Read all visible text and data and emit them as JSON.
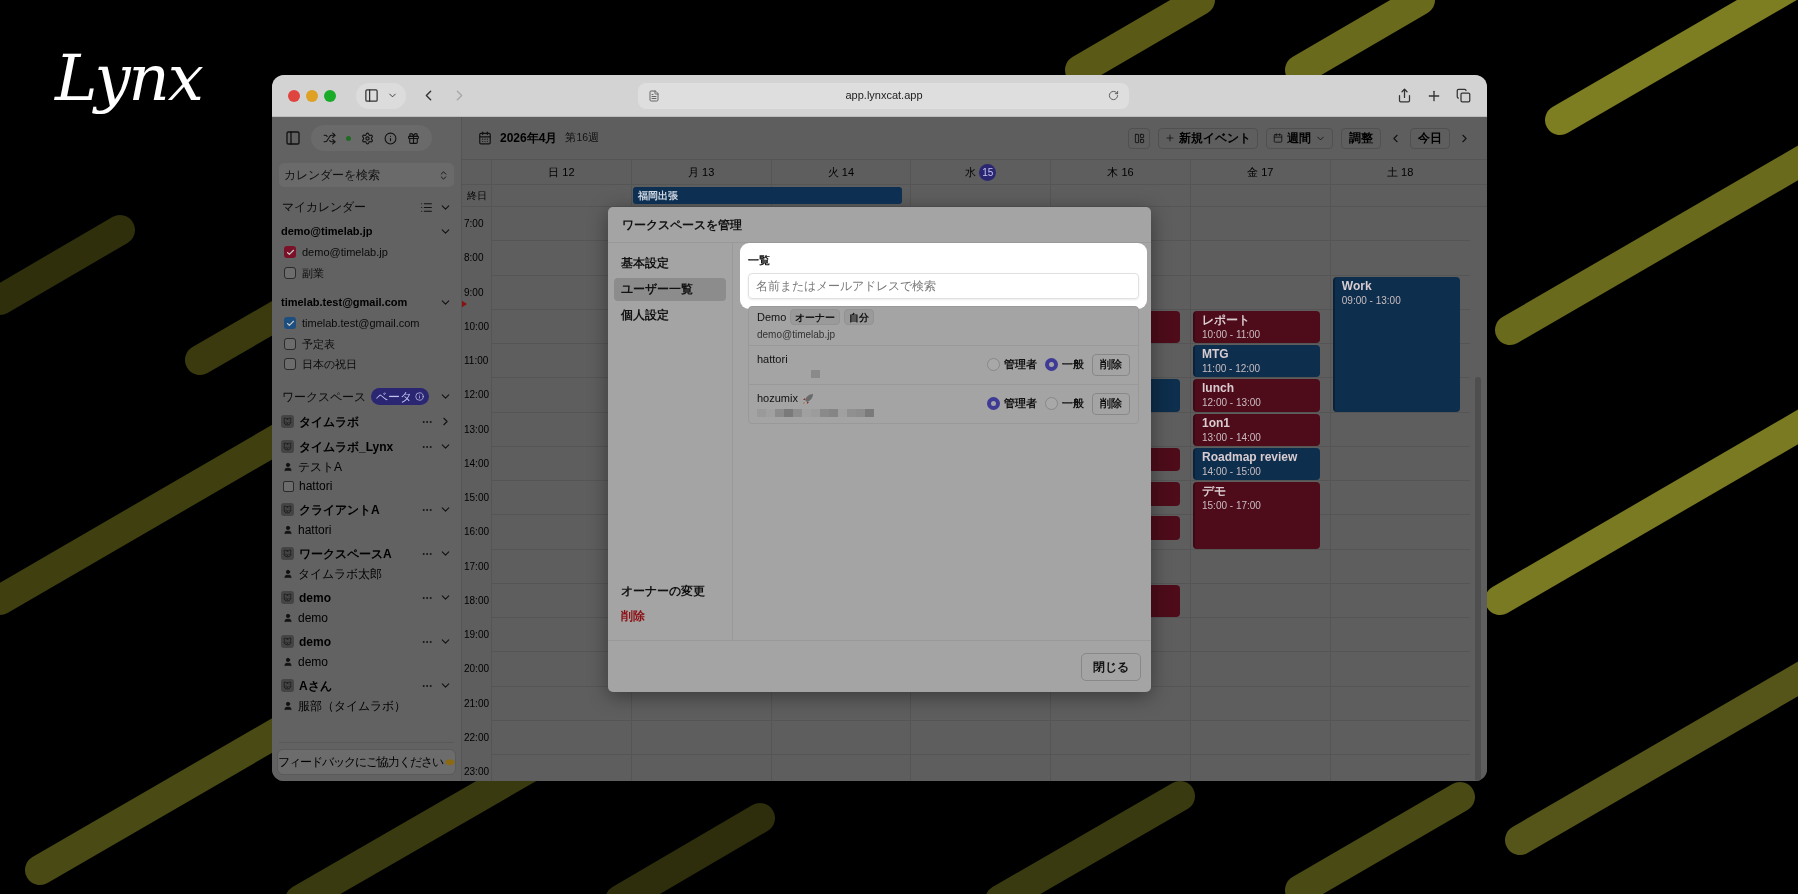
{
  "brand": "Lynx",
  "browser": {
    "url": "app.lynxcat.app"
  },
  "sidebar": {
    "search_placeholder": "カレンダーを検索",
    "my_calendars": {
      "title": "マイカレンダー",
      "accounts": [
        {
          "name": "demo@timelab.jp",
          "calendars": [
            {
              "name": "demo@timelab.jp",
              "checked": true,
              "color": "#7a1128"
            },
            {
              "name": "副業",
              "checked": false
            }
          ]
        },
        {
          "name": "timelab.test@gmail.com",
          "calendars": [
            {
              "name": "timelab.test@gmail.com",
              "checked": true,
              "color": "#1c4f80"
            },
            {
              "name": "予定表",
              "checked": false
            },
            {
              "name": "日本の祝日",
              "checked": false
            }
          ]
        }
      ]
    },
    "workspaces": {
      "title": "ワークスペース",
      "badge": "ベータ",
      "items": [
        {
          "name": "タイムラボ",
          "expanded": false
        },
        {
          "name": "タイムラボ_Lynx",
          "expanded": true,
          "members": [
            {
              "kind": "person",
              "name": "テストA"
            },
            {
              "kind": "checkbox",
              "name": "hattori",
              "checked": false
            }
          ]
        },
        {
          "name": "クライアントA",
          "expanded": true,
          "members": [
            {
              "kind": "person",
              "name": "hattori"
            }
          ]
        },
        {
          "name": "ワークスペースA",
          "expanded": true,
          "members": [
            {
              "kind": "person",
              "name": "タイムラボ太郎"
            }
          ]
        },
        {
          "name": "demo",
          "expanded": true,
          "members": [
            {
              "kind": "person",
              "name": "demo"
            }
          ]
        },
        {
          "name": "demo",
          "expanded": true,
          "members": [
            {
              "kind": "person",
              "name": "demo"
            }
          ]
        },
        {
          "name": "Aさん",
          "expanded": true,
          "members": [
            {
              "kind": "person",
              "name": "服部（タイムラボ）"
            }
          ]
        }
      ]
    },
    "feedback": {
      "label": "フィードバックにご協力ください",
      "decorated": true
    }
  },
  "header": {
    "month": "2026年4月",
    "week": "第16週",
    "new_event": "新規イベント",
    "view": "週間",
    "adjust": "調整",
    "today": "今日"
  },
  "calendar": {
    "all_day_label": "終日",
    "times": [
      "7:00",
      "8:00",
      "9:00",
      "10:00",
      "11:00",
      "12:00",
      "13:00",
      "14:00",
      "15:00",
      "16:00",
      "17:00",
      "18:00",
      "19:00",
      "20:00",
      "21:00",
      "22:00",
      "23:00"
    ],
    "days": [
      {
        "weekday": "日",
        "date": "12",
        "today": false
      },
      {
        "weekday": "月",
        "date": "13",
        "today": false,
        "all_day_events": [
          {
            "title": "福岡出張",
            "continues_next_day": true,
            "color": "#0d2f52"
          }
        ]
      },
      {
        "weekday": "火",
        "date": "14",
        "today": false
      },
      {
        "weekday": "水",
        "date": "15",
        "today": true
      },
      {
        "weekday": "木",
        "date": "16",
        "today": false
      },
      {
        "weekday": "金",
        "date": "17",
        "today": false,
        "events": [
          {
            "title": "レポート",
            "time": "10:00 - 11:00",
            "color": "#4e0c1a"
          },
          {
            "title": "MTG",
            "time": "11:00 - 12:00",
            "color": "#0d2e4c"
          },
          {
            "title": "lunch",
            "time": "12:00 - 13:00",
            "color": "#4e0c1a"
          },
          {
            "title": "1on1",
            "time": "13:00 - 14:00",
            "color": "#4e0c1a"
          },
          {
            "title": "Roadmap review",
            "time": "14:00 - 15:00",
            "color": "#0d2e4c"
          },
          {
            "title": "デモ",
            "time": "15:00 - 17:00",
            "color": "#4e0c1a"
          }
        ]
      },
      {
        "weekday": "土",
        "date": "18",
        "today": false,
        "events": [
          {
            "title": "Work",
            "time": "09:00 - 13:00",
            "color": "#0d2e4c"
          }
        ]
      }
    ]
  },
  "modal": {
    "title": "ワークスペースを管理",
    "nav": [
      {
        "label": "基本設定",
        "selected": false
      },
      {
        "label": "ユーザー一覧",
        "selected": true
      },
      {
        "label": "個人設定",
        "selected": false
      }
    ],
    "nav_bottom": [
      {
        "label": "オーナーの変更",
        "kind": "normal"
      },
      {
        "label": "削除",
        "kind": "danger"
      }
    ],
    "section_title": "一覧",
    "search_placeholder": "名前またはメールアドレスで検索",
    "members": [
      {
        "name": "Demo",
        "tags": [
          "オーナー",
          "自分"
        ],
        "email": "demo@timelab.jp"
      },
      {
        "name": "hattori",
        "redacted": true,
        "roles": [
          {
            "label": "管理者",
            "selected": false
          },
          {
            "label": "一般",
            "selected": true
          }
        ],
        "remove": "削除"
      },
      {
        "name": "hozumix",
        "redacted": true,
        "decorated": true,
        "roles": [
          {
            "label": "管理者",
            "selected": true
          },
          {
            "label": "一般",
            "selected": false
          }
        ],
        "remove": "削除"
      }
    ],
    "close": "閉じる"
  }
}
